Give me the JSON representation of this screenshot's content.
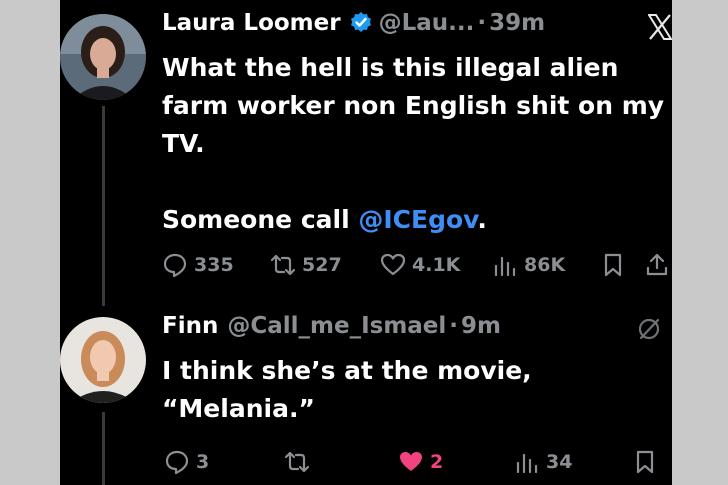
{
  "tweet1": {
    "name": "Laura Loomer",
    "handle": "@Lau...",
    "dot": "·",
    "time": "39m",
    "text_line1": "What the hell is this illegal alien",
    "text_line2": "farm worker non English shit on my",
    "text_line3": "TV.",
    "text_line4": "Someone call ",
    "mention": "@ICEgov",
    "text_end": ".",
    "replies": "335",
    "reposts": "527",
    "likes": "4.1K",
    "views": "86K"
  },
  "tweet2": {
    "name": "Finn",
    "handle": "@Call_me_Ismael",
    "dot": "·",
    "time": "9m",
    "text_line1": "I think she’s at the movie,",
    "text_line2": "“Melania.”",
    "replies": "3",
    "likes": "2",
    "views": "34"
  },
  "colors": {
    "background": "#000000",
    "link": "#3f8ef5",
    "muted": "#8b8f94",
    "like_active": "#f0437f",
    "verified": "#1d9bf0"
  },
  "icons": [
    "verified-badge-icon",
    "x-logo-icon",
    "reply-icon",
    "repost-icon",
    "like-icon",
    "views-icon",
    "bookmark-icon",
    "share-icon",
    "grok-icon"
  ]
}
